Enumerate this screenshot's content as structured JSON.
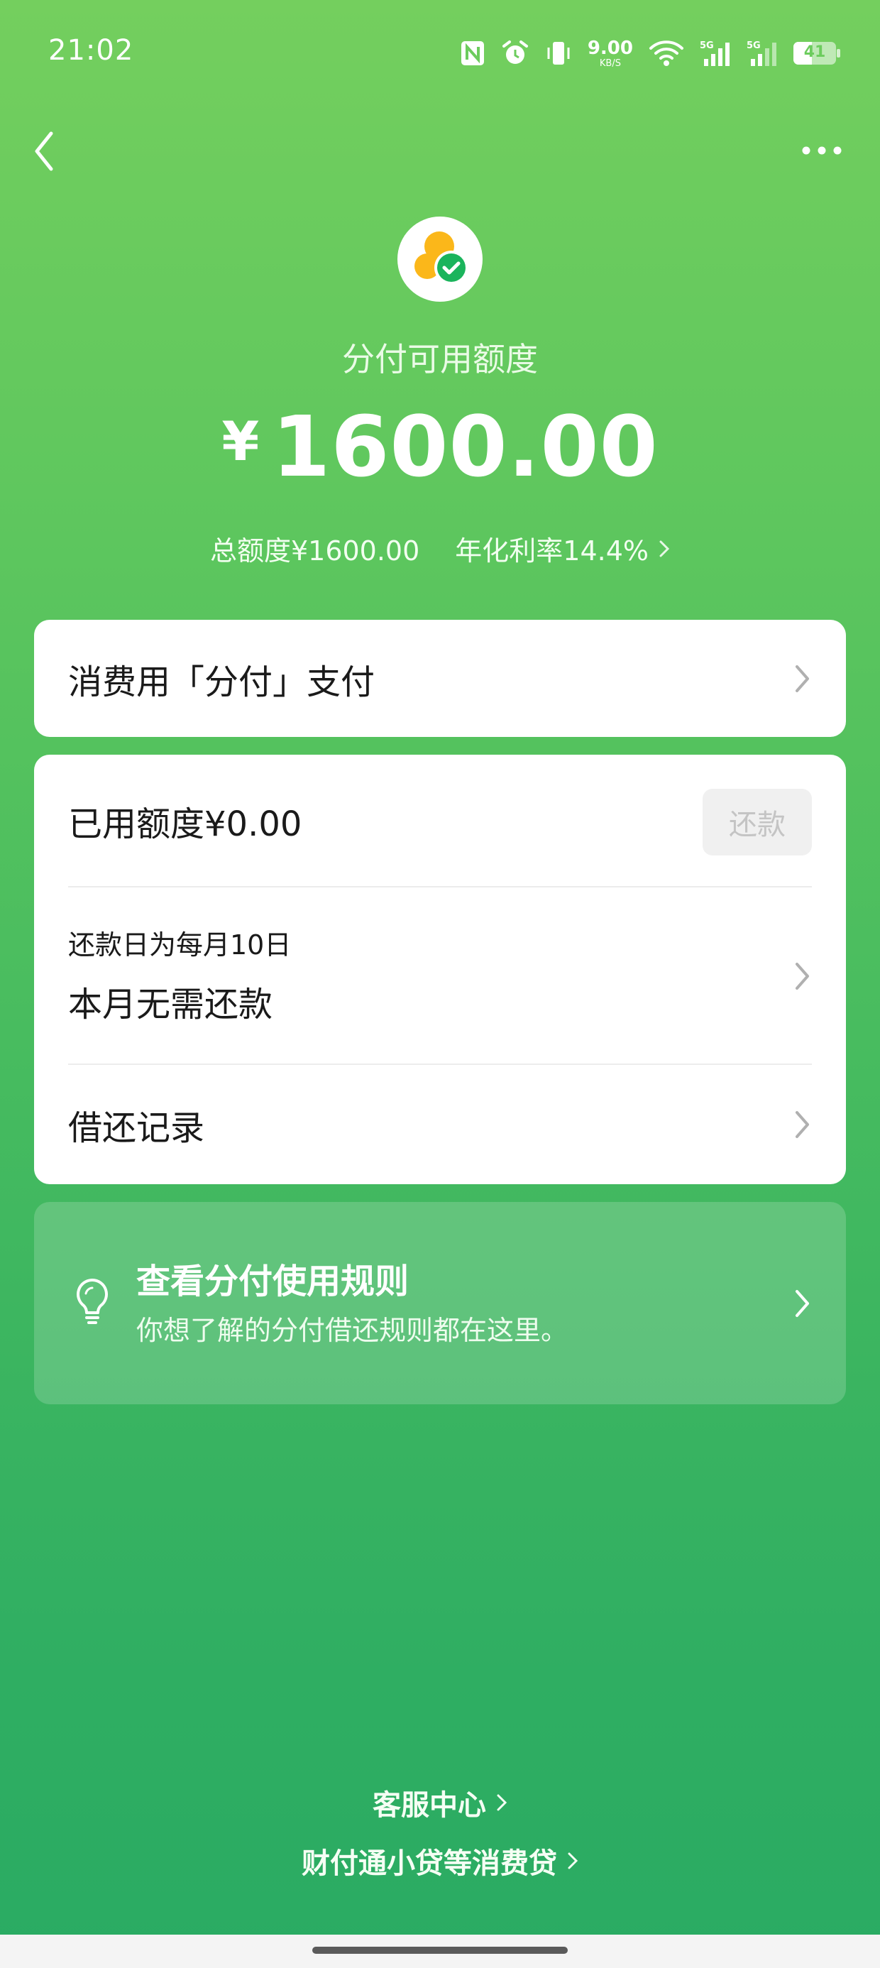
{
  "status": {
    "time": "21:02",
    "net_speed": "9.00",
    "net_unit": "KB/S",
    "battery": "41",
    "signal1": "5G",
    "signal2": "5G"
  },
  "header": {
    "label": "分付可用额度",
    "currency": "¥",
    "amount": "1600.00",
    "total": "总额度¥1600.00",
    "rate": "年化利率14.4%"
  },
  "pay": {
    "label": "消费用「分付」支付"
  },
  "usage": {
    "used": "已用额度¥0.00",
    "repay_button": "还款",
    "due_day": "还款日为每月10日",
    "due_status": "本月无需还款",
    "records": "借还记录"
  },
  "rules": {
    "title": "查看分付使用规则",
    "subtitle": "你想了解的分付借还规则都在这里。"
  },
  "footer": {
    "service": "客服中心",
    "loans": "财付通小贷等消费贷"
  },
  "colors": {
    "accent": "#07c160",
    "bg_top": "#74cf5e",
    "bg_bottom": "#2aab63"
  }
}
